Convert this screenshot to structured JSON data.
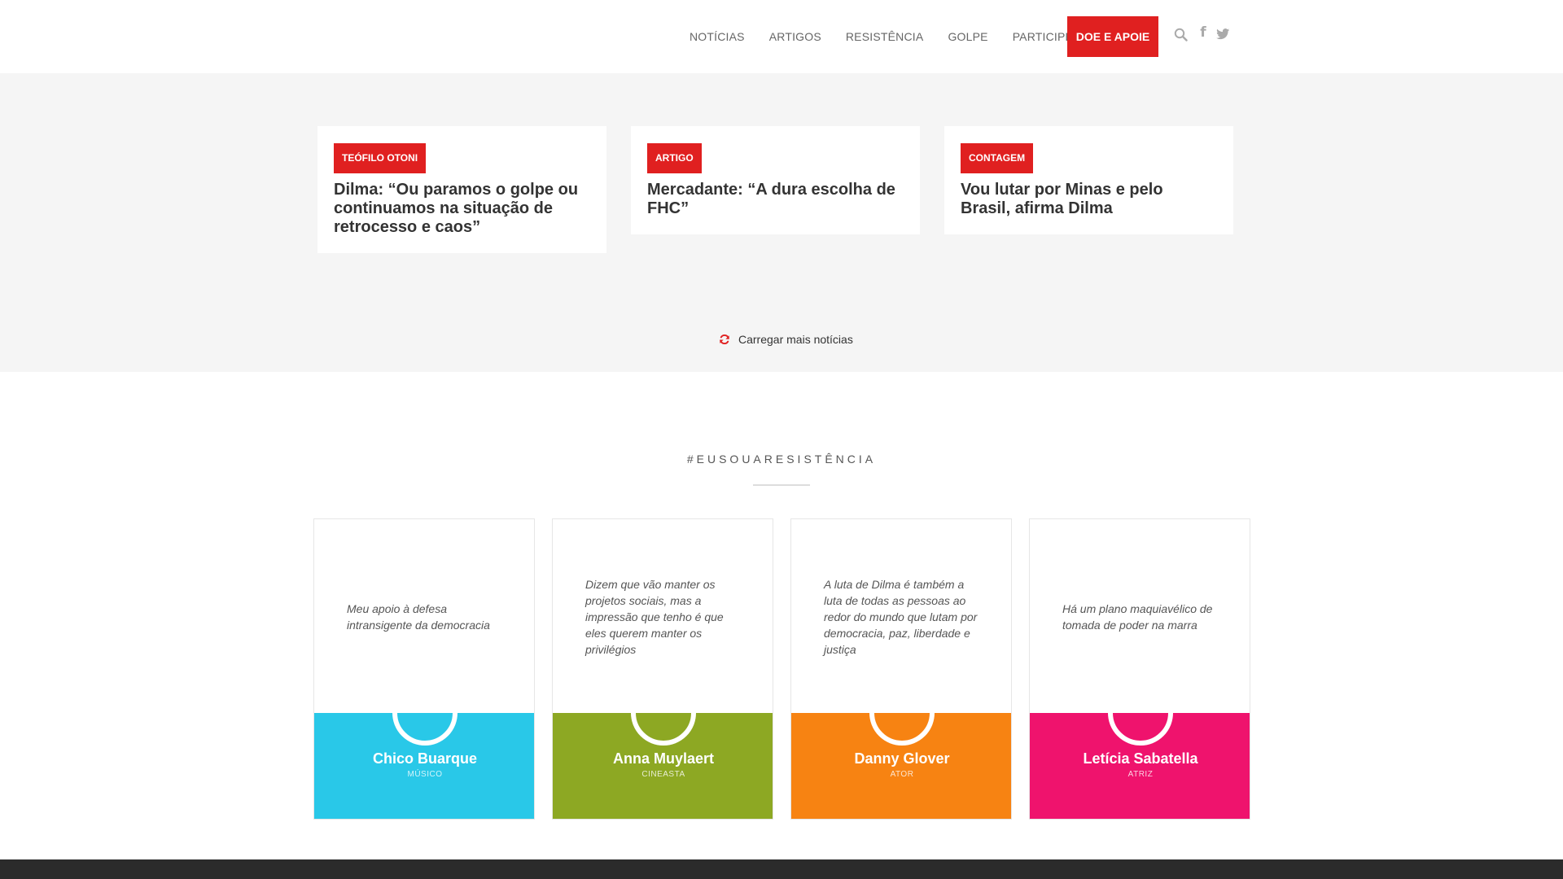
{
  "nav": {
    "items": [
      "NOTÍCIAS",
      "ARTIGOS",
      "RESISTÊNCIA",
      "GOLPE",
      "PARTICIPE"
    ],
    "cta": "DOE E APOIE",
    "icons": [
      "search-icon",
      "facebook-icon",
      "twitter-icon"
    ]
  },
  "news": {
    "cards": [
      {
        "tag": "TEÓFILO OTONI",
        "title": "Dilma: “Ou paramos o golpe ou continuamos na situação de retrocesso e caos”"
      },
      {
        "tag": "ARTIGO",
        "title": "Mercadante: “A dura escolha de FHC”"
      },
      {
        "tag": "CONTAGEM",
        "title": "Vou lutar por Minas e pelo Brasil, afirma Dilma"
      }
    ],
    "load_more": "Carregar mais notícias"
  },
  "resistance": {
    "title": "#EUSOUARESISTÊNCIA",
    "people": [
      {
        "quote": "Meu apoio à defesa intransigente da democracia",
        "name": "Chico Buarque",
        "role": "MÚSICO",
        "color": "#29c8e8"
      },
      {
        "quote": "Dizem que vão manter os projetos sociais, mas a impressão que tenho é que eles querem manter os privilégios",
        "name": "Anna Muylaert",
        "role": "CINEASTA",
        "color": "#8da823"
      },
      {
        "quote": "A luta de Dilma é também a luta de todas as pessoas ao redor do mundo que lutam por democracia, paz, liberdade e justiça",
        "name": "Danny Glover",
        "role": "ATOR",
        "color": "#f78312"
      },
      {
        "quote": "Há um plano maquiavélico de tomada de poder na marra",
        "name": "Letícia Sabatella",
        "role": "ATRIZ",
        "color": "#ef136d"
      }
    ]
  },
  "colors": {
    "accent": "#e02020",
    "news_bg": "#f5f5f5",
    "footer": "#2b2b2b"
  }
}
